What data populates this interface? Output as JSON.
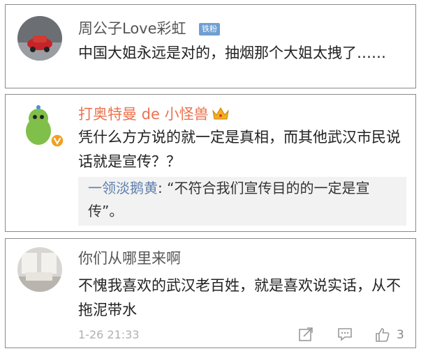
{
  "comments": [
    {
      "username": "周公子Love彩虹",
      "badge": "铁粉",
      "text": "中国大姐永远是对的，抽烟那个大姐太拽了……"
    },
    {
      "username": "打奥特曼 de 小怪兽",
      "text": "凭什么方方说的就一定是真相，而其他武汉市民说话就是宣传？？",
      "reply": {
        "author": "一领淡鹅黄",
        "text": ": “不符合我们宣传目的的一定是宣传”。"
      }
    },
    {
      "username": "你们从哪里来啊",
      "text": "不愧我喜欢的武汉老百姓，就是喜欢说实话，从不拖泥带水",
      "timestamp": "1-26 21:33",
      "like_count": "3"
    }
  ],
  "colors": {
    "card_border": "#8a8a8a",
    "username_plain": "#555555",
    "username_vip": "#eb7350",
    "reply_author": "#5f7fae",
    "badge_bg": "#6f9fd2",
    "meta_gray": "#b0b0b0"
  },
  "icons": [
    "crown-icon",
    "verified-v-icon",
    "share-icon",
    "comment-icon",
    "like-icon"
  ]
}
